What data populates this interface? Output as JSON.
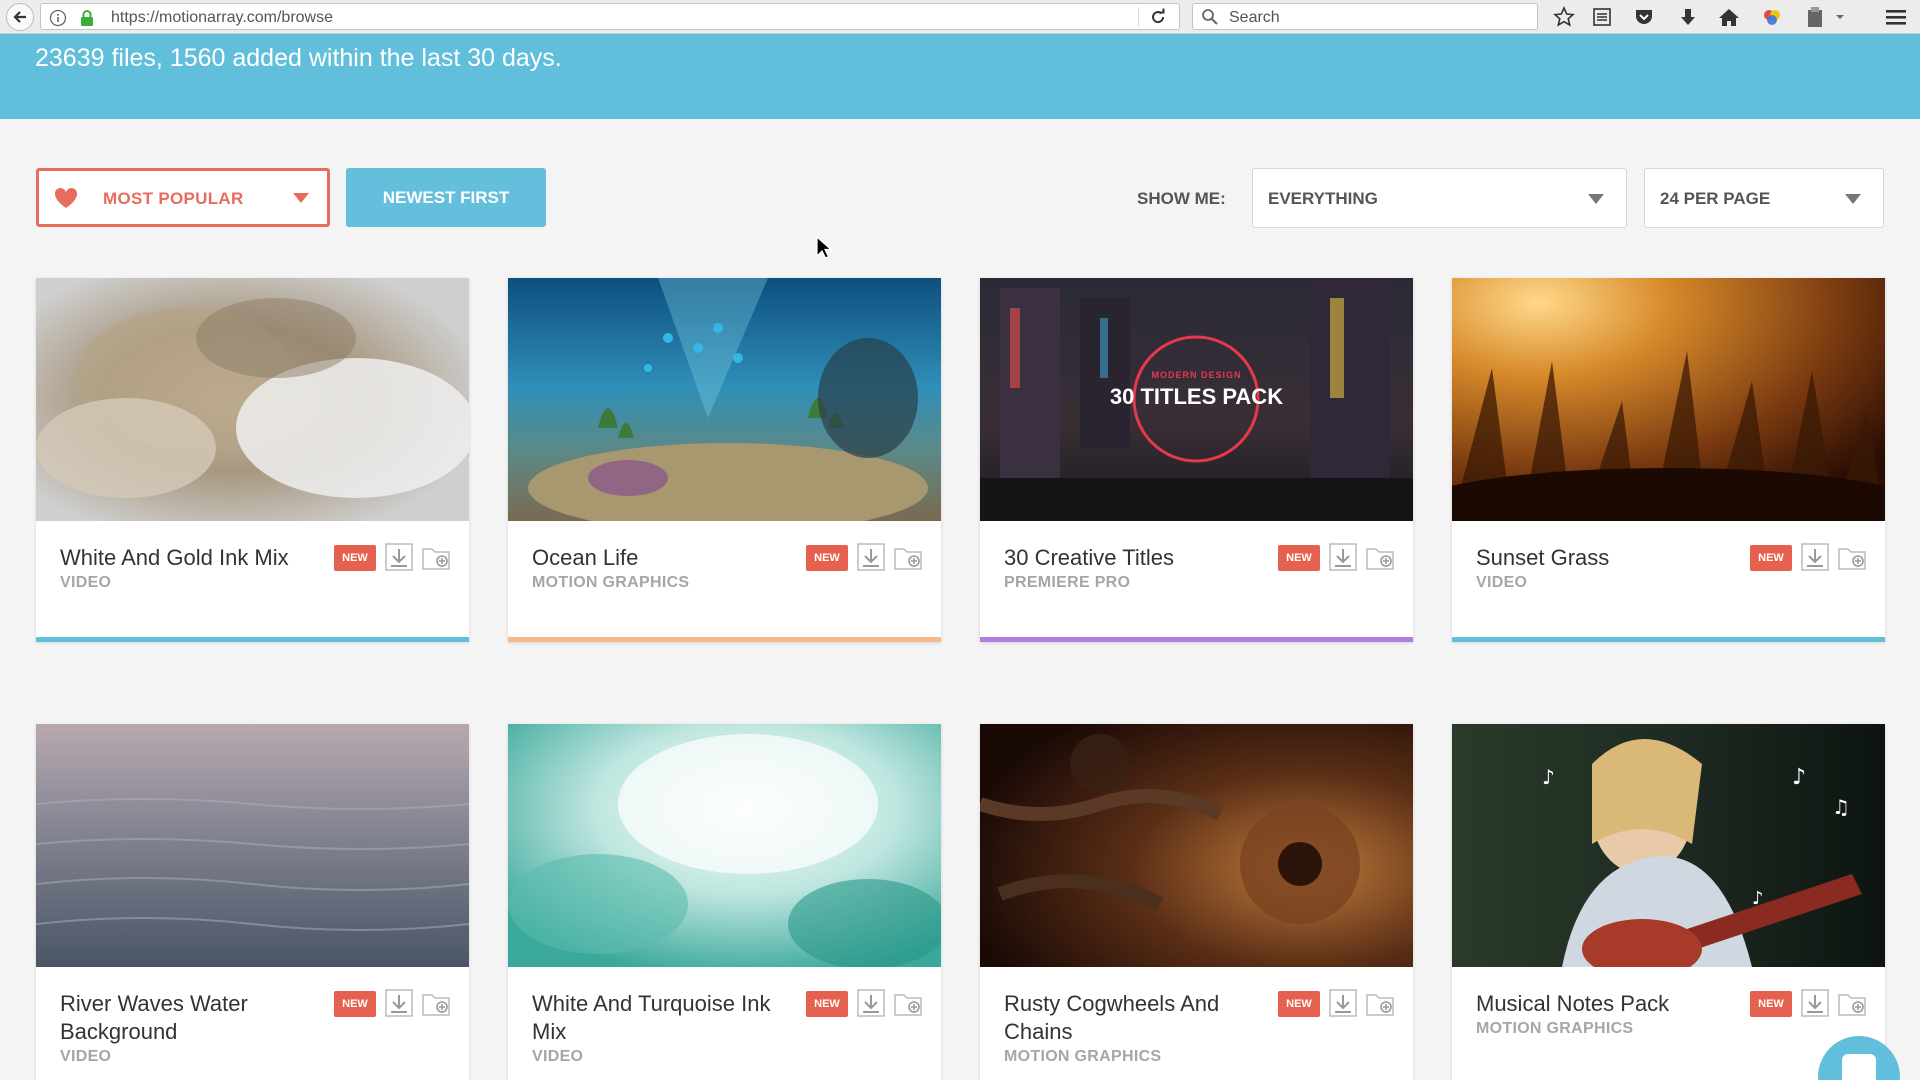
{
  "browser": {
    "url": "https://motionarray.com/browse",
    "search_placeholder": "Search"
  },
  "hero": {
    "summary": "23639 files, 1560 added within the last 30 days."
  },
  "controls": {
    "popular_label": "MOST POPULAR",
    "newest_label": "NEWEST FIRST",
    "show_me_label": "SHOW ME:",
    "type_select": "EVERYTHING",
    "per_page_select": "24 PER PAGE"
  },
  "colors": {
    "accent_blue": "#62bfdc",
    "accent_red": "#e66d5c",
    "video_bar": "#62bfdc",
    "motion_graphics_bar": "#f5b98c",
    "premiere_pro_bar": "#b47ddc"
  },
  "cards": [
    {
      "title": "White And Gold Ink Mix",
      "category": "VIDEO",
      "badge": "NEW",
      "bar_color": "#62bfdc"
    },
    {
      "title": "Ocean Life",
      "category": "MOTION GRAPHICS",
      "badge": "NEW",
      "bar_color": "#f5b98c"
    },
    {
      "title": "30 Creative Titles",
      "category": "PREMIERE PRO",
      "badge": "NEW",
      "bar_color": "#b47ddc",
      "thumb_text": "30 TITLES PACK",
      "thumb_subtext": "MODERN DESIGN"
    },
    {
      "title": "Sunset Grass",
      "category": "VIDEO",
      "badge": "NEW",
      "bar_color": "#62bfdc"
    },
    {
      "title": "River Waves Water Background",
      "category": "VIDEO",
      "badge": "NEW"
    },
    {
      "title": "White And Turquoise Ink Mix",
      "category": "VIDEO",
      "badge": "NEW"
    },
    {
      "title": "Rusty Cogwheels And Chains",
      "category": "MOTION GRAPHICS",
      "badge": "NEW"
    },
    {
      "title": "Musical Notes Pack",
      "category": "MOTION GRAPHICS",
      "badge": "NEW"
    }
  ]
}
